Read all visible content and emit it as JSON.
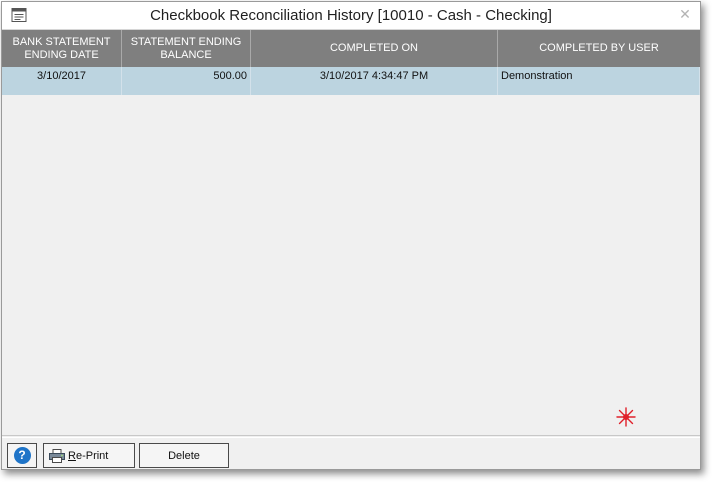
{
  "window": {
    "title": "Checkbook Reconciliation History [10010 - Cash - Checking]",
    "close_glyph": "✕"
  },
  "grid": {
    "columns": [
      {
        "label": "BANK STATEMENT\nENDING DATE"
      },
      {
        "label": "STATEMENT ENDING\nBALANCE"
      },
      {
        "label": "COMPLETED ON"
      },
      {
        "label": "COMPLETED BY USER"
      }
    ],
    "rows": [
      {
        "ending_date": "3/10/2017",
        "ending_balance": "500.00",
        "completed_on": "3/10/2017 4:34:47 PM",
        "completed_by": "Demonstration"
      }
    ]
  },
  "footer": {
    "help_label": "?",
    "reprint_first": "R",
    "reprint_rest": "e-Print",
    "delete_label": "Delete"
  },
  "colors": {
    "header_bg": "#7f7f7f",
    "selected_row_bg": "#bcd4e0",
    "window_bg": "#f0f0f0",
    "help_icon": "#1f74c8",
    "cursor_marker": "#e0202a"
  }
}
